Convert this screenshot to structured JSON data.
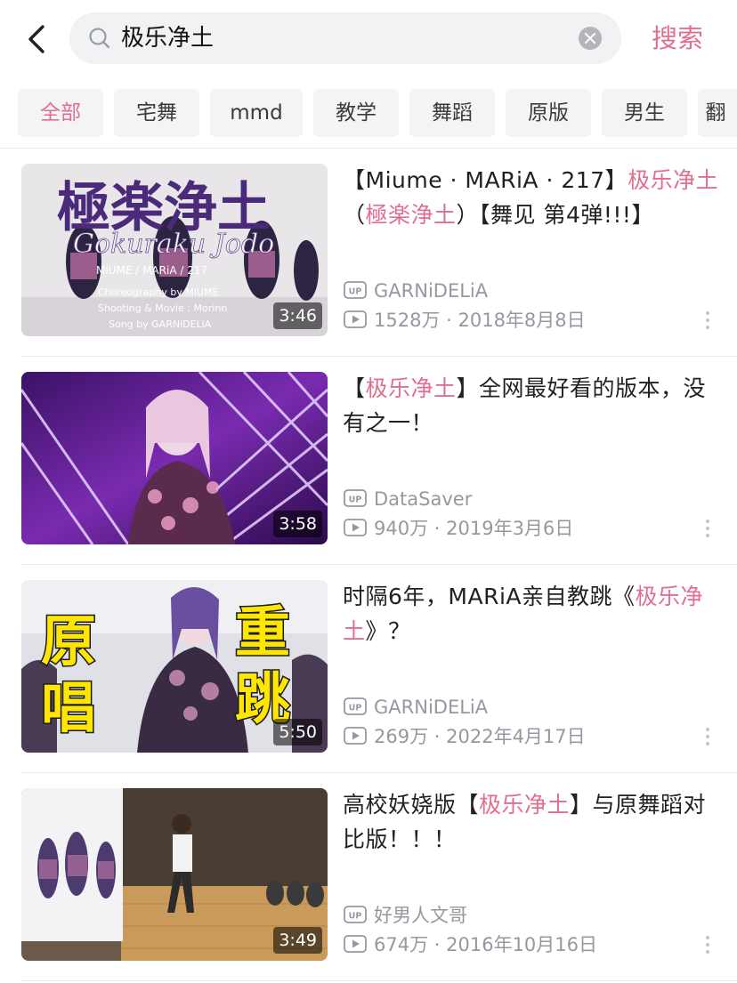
{
  "search": {
    "query": "极乐净土",
    "button_label": "搜索"
  },
  "icons": {
    "back": "chevron-left-icon",
    "search": "search-icon",
    "clear": "clear-icon",
    "uploader": "up-badge-icon",
    "plays": "play-count-icon",
    "more": "more-vertical-icon"
  },
  "colors": {
    "accent": "#e06f8f",
    "meta_text": "#9499a0",
    "tab_bg": "#f4f4f5"
  },
  "tabs": [
    {
      "label": "全部",
      "active": true
    },
    {
      "label": "宅舞",
      "active": false
    },
    {
      "label": "mmd",
      "active": false
    },
    {
      "label": "教学",
      "active": false
    },
    {
      "label": "舞蹈",
      "active": false
    },
    {
      "label": "原版",
      "active": false
    },
    {
      "label": "男生",
      "active": false
    },
    {
      "label": "翻",
      "active": false
    }
  ],
  "videos": [
    {
      "title_parts": [
        {
          "text": "【Miume · MARiA · 217】",
          "hl": false
        },
        {
          "text": "极乐净土",
          "hl": true
        },
        {
          "text": "（",
          "hl": false
        },
        {
          "text": "極楽浄土",
          "hl": true
        },
        {
          "text": "）【舞见 第4弹!!!】",
          "hl": false
        }
      ],
      "uploader": "GARNiDELiA",
      "plays": "1528万",
      "date": "2018年8月8日",
      "duration": "3:46",
      "thumb_text": {
        "title": "極楽浄土",
        "subtitle": "Gokuraku Jodo",
        "credit1": "MiUME / MARiA / 217",
        "credit2": "Choreography by MiUME",
        "credit3": "Shooting & Movie : Morinn",
        "credit4": "Song by GARNiDELiA"
      }
    },
    {
      "title_parts": [
        {
          "text": "【",
          "hl": false
        },
        {
          "text": "极乐净土",
          "hl": true
        },
        {
          "text": "】全网最好看的版本，没有之一！",
          "hl": false
        }
      ],
      "uploader": "DataSaver",
      "plays": "940万",
      "date": "2019年3月6日",
      "duration": "3:58"
    },
    {
      "title_parts": [
        {
          "text": "时隔6年，MARiA亲自教跳《",
          "hl": false
        },
        {
          "text": "极乐净土",
          "hl": true
        },
        {
          "text": "》？",
          "hl": false
        }
      ],
      "uploader": "GARNiDELiA",
      "plays": "269万",
      "date": "2022年4月17日",
      "duration": "5:50",
      "thumb_text": {
        "left": "原唱",
        "right": "重跳"
      }
    },
    {
      "title_parts": [
        {
          "text": "高校妖娆版【",
          "hl": false
        },
        {
          "text": "极乐净土",
          "hl": true
        },
        {
          "text": "】与原舞蹈对比版！！！",
          "hl": false
        }
      ],
      "uploader": "好男人文哥",
      "plays": "674万",
      "date": "2016年10月16日",
      "duration": "3:49"
    }
  ]
}
